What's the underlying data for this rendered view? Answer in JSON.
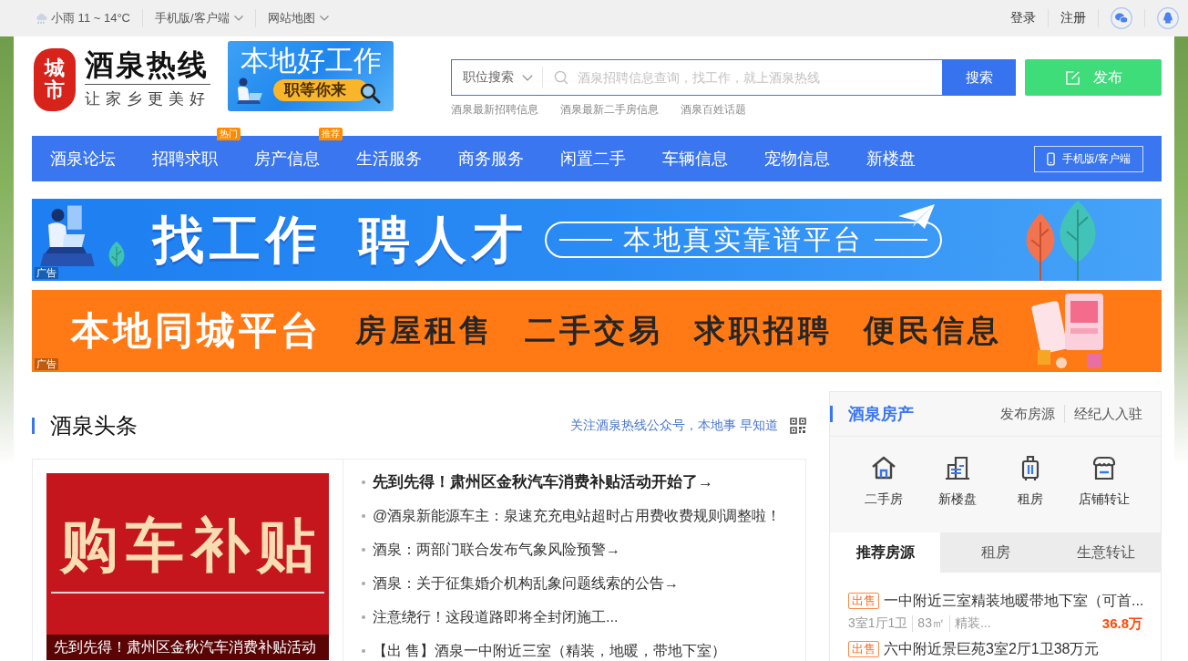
{
  "top_bar": {
    "weather": "小雨 11 ~ 14°C",
    "links": [
      {
        "label": "手机版/客户端",
        "dropdown": true
      },
      {
        "label": "网站地图",
        "dropdown": true
      }
    ],
    "account_links": [
      "登录",
      "注册"
    ]
  },
  "header": {
    "logo": {
      "emblem": "城市",
      "name": "酒泉热线",
      "slogan": "让家乡更美好"
    },
    "ad": {
      "title": "本地好工作",
      "subtitle": "职等你来"
    },
    "search": {
      "category": "职位搜索",
      "placeholder": "酒泉招聘信息查询，找工作，就上酒泉热线",
      "button": "搜索"
    },
    "quick_links": [
      "酒泉最新招聘信息",
      "酒泉最新二手房信息",
      "酒泉百姓话题"
    ],
    "publish_button": "发布"
  },
  "nav": {
    "items": [
      {
        "label": "酒泉论坛"
      },
      {
        "label": "招聘求职",
        "badge": "热门"
      },
      {
        "label": "房产信息",
        "badge": "推荐"
      },
      {
        "label": "生活服务"
      },
      {
        "label": "商务服务"
      },
      {
        "label": "闲置二手"
      },
      {
        "label": "车辆信息"
      },
      {
        "label": "宠物信息"
      },
      {
        "label": "新楼盘"
      }
    ],
    "mobile_button": "手机版/客户端"
  },
  "banners": [
    {
      "kind": "jobs",
      "headline": [
        "找工作",
        "聘人才"
      ],
      "slogan": "本地真实靠谱平台",
      "label": "广告"
    },
    {
      "kind": "services",
      "headline": [
        "本地同城平台"
      ],
      "services": [
        "房屋租售",
        "二手交易",
        "求职招聘",
        "便民信息"
      ],
      "label": "广告"
    }
  ],
  "headlines": {
    "title": "酒泉头条",
    "follow_text": "关注酒泉热线公众号，本地事 早知道",
    "featured": {
      "image_text": "购车补贴",
      "caption": "先到先得！肃州区金秋汽车消费补贴活动"
    },
    "items": [
      {
        "text": "先到先得！肃州区金秋汽车消费补贴活动开始了→",
        "emphasized": true
      },
      {
        "text": "@酒泉新能源车主：泉速充充电站超时占用费收费规则调整啦！",
        "emphasized": false
      },
      {
        "text": "酒泉：两部门联合发布气象风险预警→",
        "emphasized": false
      },
      {
        "text": "酒泉：关于征集婚介机构乱象问题线索的公告→",
        "emphasized": false
      },
      {
        "text": "注意绕行！这段道路即将全封闭施工...",
        "emphasized": false
      },
      {
        "text": "【出 售】酒泉一中附近三室（精装，地暖，带地下室）",
        "emphasized": false
      }
    ]
  },
  "property": {
    "title": "酒泉房产",
    "links": [
      "发布房源",
      "经纪人入驻"
    ],
    "categories": [
      {
        "kind": "house",
        "label": "二手房"
      },
      {
        "kind": "building",
        "label": "新楼盘"
      },
      {
        "kind": "luggage",
        "label": "租房"
      },
      {
        "kind": "shop",
        "label": "店铺转让"
      }
    ],
    "tabs": [
      {
        "label": "推荐房源",
        "selected": true
      },
      {
        "label": "租房",
        "selected": false
      },
      {
        "label": "生意转让",
        "selected": false
      }
    ],
    "listings": [
      {
        "tag": "出售",
        "title": "一中附近三室精装地暖带地下室（可首...",
        "details": [
          "3室1厅1卫",
          "83㎡",
          "精装..."
        ],
        "price": "36.8万"
      },
      {
        "tag": "出售",
        "title": "六中附近景巨苑3室2厅1卫38万元"
      }
    ]
  }
}
